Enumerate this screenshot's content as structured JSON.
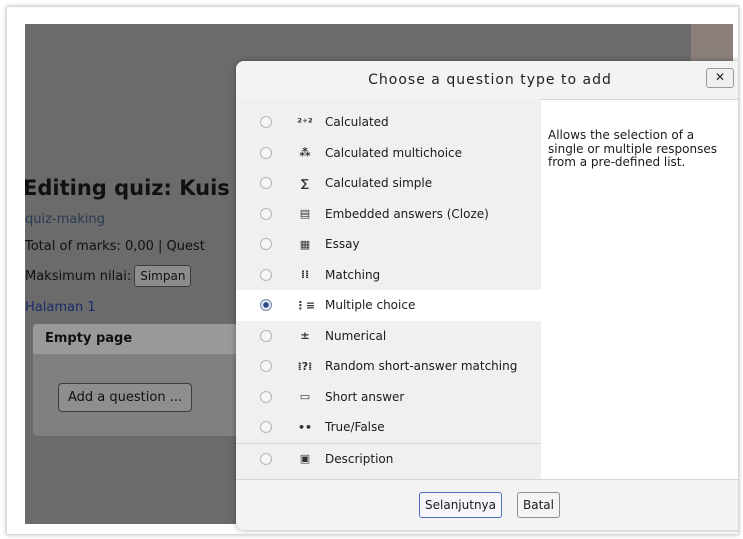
{
  "page": {
    "quiz_title": "Editing quiz: Kuis",
    "breadcrumb_tag": "quiz-making",
    "total_marks": "Total of marks: 0,00 | Quest",
    "max_grade_label": "Maksimum nilai:",
    "save_button": "Simpan",
    "page_link": "Halaman 1",
    "empty_page_heading": "Empty page",
    "add_question_button": "Add a question ..."
  },
  "dialog": {
    "title": "Choose a question type to add",
    "close_label": "✕",
    "options": [
      {
        "label": "Calculated",
        "icon": "calculated-icon",
        "glyph": "²⁺²",
        "selected": false
      },
      {
        "label": "Calculated multichoice",
        "icon": "calculated-multichoice-icon",
        "glyph": "⁂",
        "selected": false
      },
      {
        "label": "Calculated simple",
        "icon": "calculated-simple-icon",
        "glyph": "∑",
        "selected": false
      },
      {
        "label": "Embedded answers (Cloze)",
        "icon": "cloze-icon",
        "glyph": "▤",
        "selected": false
      },
      {
        "label": "Essay",
        "icon": "essay-icon",
        "glyph": "▦",
        "selected": false
      },
      {
        "label": "Matching",
        "icon": "matching-icon",
        "glyph": "⁞⁞",
        "selected": false
      },
      {
        "label": "Multiple choice",
        "icon": "multiple-choice-icon",
        "glyph": "⋮≡",
        "selected": true
      },
      {
        "label": "Numerical",
        "icon": "numerical-icon",
        "glyph": "±",
        "selected": false
      },
      {
        "label": "Random short-answer matching",
        "icon": "random-short-answer-icon",
        "glyph": "⁞?⁞",
        "selected": false
      },
      {
        "label": "Short answer",
        "icon": "short-answer-icon",
        "glyph": "▭",
        "selected": false
      },
      {
        "label": "True/False",
        "icon": "true-false-icon",
        "glyph": "••",
        "selected": false
      },
      {
        "label": "Description",
        "icon": "description-icon",
        "glyph": "▣",
        "selected": false
      }
    ],
    "summary": "Allows the selection of a single or multiple responses from a pre-defined list.",
    "next_button": "Selanjutnya",
    "cancel_button": "Batal"
  }
}
